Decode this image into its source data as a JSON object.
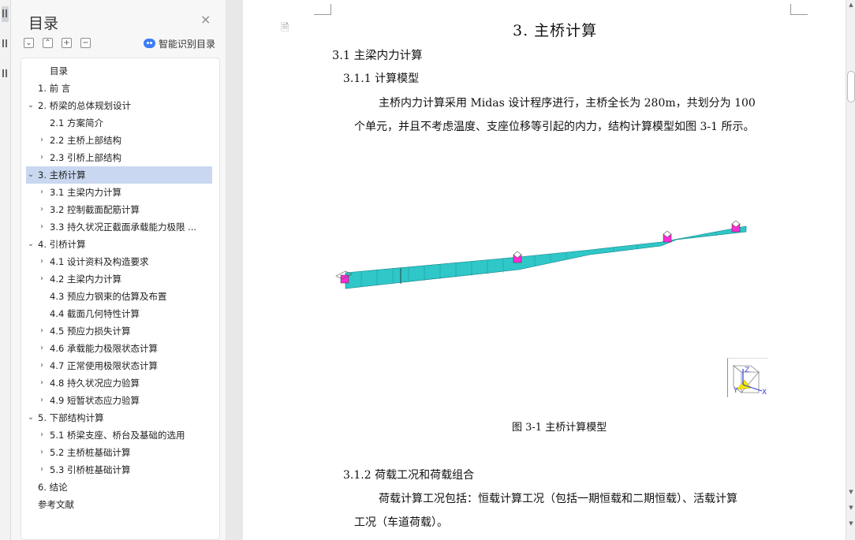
{
  "nav": {
    "title": "目录",
    "close_glyph": "×",
    "controls": {
      "collapse": "⌄",
      "expand": "⌃",
      "plus": "+",
      "minus": "−"
    },
    "smart_toc_label": "智能识别目录",
    "items": [
      {
        "text": "目录",
        "level": 1,
        "chevron": ""
      },
      {
        "text": "1.   前 言",
        "level": 0,
        "chevron": ""
      },
      {
        "text": "2.   桥梁的总体规划设计",
        "level": 0,
        "chevron": "⌄"
      },
      {
        "text": "2.1  方案简介",
        "level": 1,
        "chevron": ""
      },
      {
        "text": "2.2  主桥上部结构",
        "level": 1,
        "chevron": "›"
      },
      {
        "text": "2.3  引桥上部结构",
        "level": 1,
        "chevron": "›"
      },
      {
        "text": "3.   主桥计算",
        "level": 0,
        "chevron": "⌄",
        "selected": true
      },
      {
        "text": "3.1  主梁内力计算",
        "level": 1,
        "chevron": "›"
      },
      {
        "text": "3.2  控制截面配筋计算",
        "level": 1,
        "chevron": "›"
      },
      {
        "text": "3.3  持久状况正截面承载能力极限 ...",
        "level": 1,
        "chevron": "›"
      },
      {
        "text": "4.   引桥计算",
        "level": 0,
        "chevron": "⌄"
      },
      {
        "text": "4.1  设计资料及构造要求",
        "level": 1,
        "chevron": "›"
      },
      {
        "text": "4.2  主梁内力计算",
        "level": 1,
        "chevron": "›"
      },
      {
        "text": "4.3  预应力钢束的估算及布置",
        "level": 1,
        "chevron": ""
      },
      {
        "text": "4.4  截面几何特性计算",
        "level": 1,
        "chevron": ""
      },
      {
        "text": "4.5  预应力损失计算",
        "level": 1,
        "chevron": "›"
      },
      {
        "text": "4.6  承载能力极限状态计算",
        "level": 1,
        "chevron": "›"
      },
      {
        "text": "4.7  正常使用极限状态计算",
        "level": 1,
        "chevron": "›"
      },
      {
        "text": "4.8  持久状况应力验算",
        "level": 1,
        "chevron": "›"
      },
      {
        "text": "4.9  短暂状态应力验算",
        "level": 1,
        "chevron": "›"
      },
      {
        "text": "5.   下部结构计算",
        "level": 0,
        "chevron": "⌄"
      },
      {
        "text": "5.1  桥梁支座、桥台及基础的选用",
        "level": 1,
        "chevron": "›"
      },
      {
        "text": "5.2  主桥桩基础计算",
        "level": 1,
        "chevron": "›"
      },
      {
        "text": "5.3  引桥桩基础计算",
        "level": 1,
        "chevron": "›"
      },
      {
        "text": "6.   结论",
        "level": 0,
        "chevron": ""
      },
      {
        "text": "参考文献",
        "level": 0,
        "chevron": ""
      }
    ]
  },
  "doc": {
    "heading1": "3.    主桥计算",
    "heading2": "3.1  主梁内力计算",
    "heading3a": "3.1.1 计算模型",
    "para1_line1": "主桥内力计算采用 Midas 设计程序进行，主桥全长为 280m，共划分为 100",
    "para1_line2": "个单元，并且不考虑温度、支座位移等引起的内力，结构计算模型如图 3-1 所示。",
    "figure_caption": "图 3-1  主桥计算模型",
    "heading3b": "3.1.2 荷载工况和荷载组合",
    "para2_line1": "荷载计算工况包括：恒载计算工况（包括一期恒载和二期恒载）、活载计算",
    "para2_line2": "工况（车道荷载）。",
    "axis_labels": {
      "z": "Z",
      "y": "Y",
      "x": "X"
    },
    "doc_icon": "🗎"
  },
  "colors": {
    "bridge_fill": "#2fc7c7",
    "bridge_stroke": "#0f7d86",
    "support_magenta": "#ff2bd6",
    "selection": "#c9d8f0",
    "axis_blue": "#2e3fe0",
    "axis_yellow": "#f5e600"
  },
  "scrollbar": {
    "up": "▲",
    "down1": "▼",
    "down2": "▼",
    "down3": "▼"
  }
}
